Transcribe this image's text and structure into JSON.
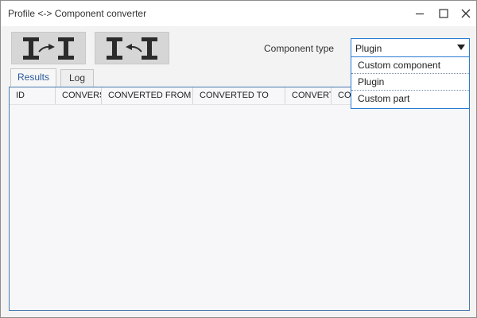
{
  "window": {
    "title": "Profile <-> Component converter",
    "controls": [
      "minimize-icon",
      "maximize-icon",
      "close-icon"
    ]
  },
  "toolbar": {
    "buttons": [
      {
        "name": "profile-to-component",
        "icon": "profile-to-component-icon"
      },
      {
        "name": "component-to-profile",
        "icon": "component-to-profile-icon"
      }
    ]
  },
  "component_type": {
    "label": "Component type",
    "selected": "Plugin",
    "options": [
      "Custom component",
      "Plugin",
      "Custom part"
    ]
  },
  "tabs": [
    {
      "label": "Results",
      "active": true
    },
    {
      "label": "Log",
      "active": false
    }
  ],
  "grid": {
    "columns": [
      "ID",
      "CONVERS",
      "CONVERTED FROM",
      "CONVERTED TO",
      "CONVERT",
      "CO"
    ]
  },
  "colors": {
    "accent": "#2a7bd4",
    "active_tab_text": "#2a5a9a",
    "button_bg": "#d6d6d6"
  }
}
